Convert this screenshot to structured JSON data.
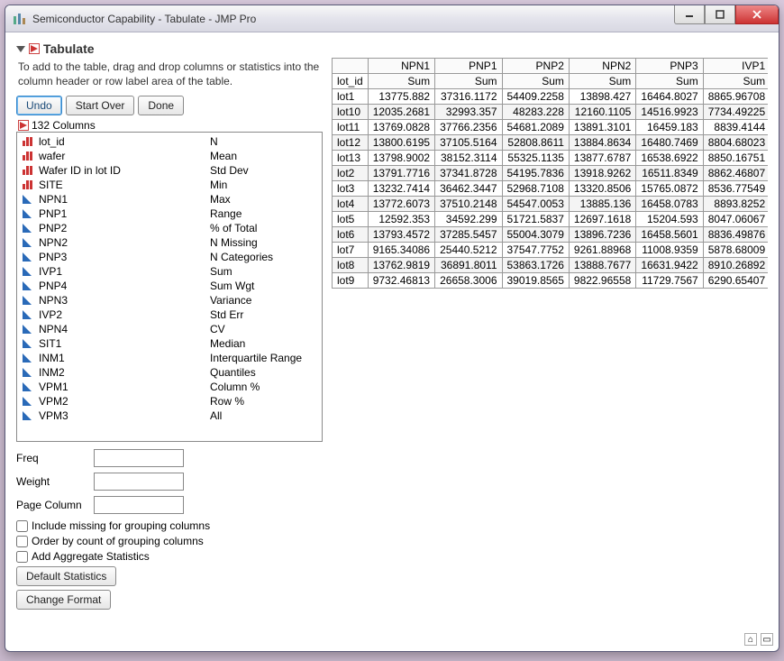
{
  "window": {
    "title": "Semiconductor Capability - Tabulate - JMP Pro"
  },
  "section": {
    "title": "Tabulate",
    "help": "To add to the table, drag and drop columns or statistics into the column header or row label area of the table."
  },
  "toolbar": {
    "undo": "Undo",
    "start_over": "Start Over",
    "done": "Done"
  },
  "columns": {
    "count_label": "132 Columns",
    "items": [
      {
        "label": "lot_id",
        "icon": "bars"
      },
      {
        "label": "wafer",
        "icon": "bars"
      },
      {
        "label": "Wafer ID in lot ID",
        "icon": "bars"
      },
      {
        "label": "SITE",
        "icon": "bars"
      },
      {
        "label": "NPN1",
        "icon": "tri"
      },
      {
        "label": "PNP1",
        "icon": "tri"
      },
      {
        "label": "PNP2",
        "icon": "tri"
      },
      {
        "label": "NPN2",
        "icon": "tri"
      },
      {
        "label": "PNP3",
        "icon": "tri"
      },
      {
        "label": "IVP1",
        "icon": "tri"
      },
      {
        "label": "PNP4",
        "icon": "tri"
      },
      {
        "label": "NPN3",
        "icon": "tri"
      },
      {
        "label": "IVP2",
        "icon": "tri"
      },
      {
        "label": "NPN4",
        "icon": "tri"
      },
      {
        "label": "SIT1",
        "icon": "tri"
      },
      {
        "label": "INM1",
        "icon": "tri"
      },
      {
        "label": "INM2",
        "icon": "tri"
      },
      {
        "label": "VPM1",
        "icon": "tri"
      },
      {
        "label": "VPM2",
        "icon": "tri"
      },
      {
        "label": "VPM3",
        "icon": "tri"
      }
    ]
  },
  "statistics": [
    "N",
    "Mean",
    "Std Dev",
    "Min",
    "Max",
    "Range",
    "% of Total",
    "N Missing",
    "N Categories",
    "Sum",
    "Sum Wgt",
    "Variance",
    "Std Err",
    "CV",
    "Median",
    "Interquartile Range",
    "Quantiles",
    "Column %",
    "Row %",
    "All"
  ],
  "form": {
    "freq_label": "Freq",
    "weight_label": "Weight",
    "page_col_label": "Page Column",
    "chk_missing": "Include missing for grouping columns",
    "chk_order": "Order by count of grouping columns",
    "chk_aggregate": "Add Aggregate Statistics",
    "btn_default": "Default Statistics",
    "btn_format": "Change Format"
  },
  "table": {
    "corner": "lot_id",
    "cols": [
      "NPN1",
      "PNP1",
      "PNP2",
      "NPN2",
      "PNP3",
      "IVP1"
    ],
    "stat_row": "Sum",
    "rows": [
      {
        "id": "lot1",
        "v": [
          "13775.882",
          "37316.1172",
          "54409.2258",
          "13898.427",
          "16464.8027",
          "8865.96708"
        ]
      },
      {
        "id": "lot10",
        "v": [
          "12035.2681",
          "32993.357",
          "48283.228",
          "12160.1105",
          "14516.9923",
          "7734.49225"
        ]
      },
      {
        "id": "lot11",
        "v": [
          "13769.0828",
          "37766.2356",
          "54681.2089",
          "13891.3101",
          "16459.183",
          "8839.4144"
        ]
      },
      {
        "id": "lot12",
        "v": [
          "13800.6195",
          "37105.5164",
          "52808.8611",
          "13884.8634",
          "16480.7469",
          "8804.68023"
        ]
      },
      {
        "id": "lot13",
        "v": [
          "13798.9002",
          "38152.3114",
          "55325.1135",
          "13877.6787",
          "16538.6922",
          "8850.16751"
        ]
      },
      {
        "id": "lot2",
        "v": [
          "13791.7716",
          "37341.8728",
          "54195.7836",
          "13918.9262",
          "16511.8349",
          "8862.46807"
        ]
      },
      {
        "id": "lot3",
        "v": [
          "13232.7414",
          "36462.3447",
          "52968.7108",
          "13320.8506",
          "15765.0872",
          "8536.77549"
        ]
      },
      {
        "id": "lot4",
        "v": [
          "13772.6073",
          "37510.2148",
          "54547.0053",
          "13885.136",
          "16458.0783",
          "8893.8252"
        ]
      },
      {
        "id": "lot5",
        "v": [
          "12592.353",
          "34592.299",
          "51721.5837",
          "12697.1618",
          "15204.593",
          "8047.06067"
        ]
      },
      {
        "id": "lot6",
        "v": [
          "13793.4572",
          "37285.5457",
          "55004.3079",
          "13896.7236",
          "16458.5601",
          "8836.49876"
        ]
      },
      {
        "id": "lot7",
        "v": [
          "9165.34086",
          "25440.5212",
          "37547.7752",
          "9261.88968",
          "11008.9359",
          "5878.68009"
        ]
      },
      {
        "id": "lot8",
        "v": [
          "13762.9819",
          "36891.8011",
          "53863.1726",
          "13888.7677",
          "16631.9422",
          "8910.26892"
        ]
      },
      {
        "id": "lot9",
        "v": [
          "9732.46813",
          "26658.3006",
          "39019.8565",
          "9822.96558",
          "11729.7567",
          "6290.65407"
        ]
      }
    ]
  }
}
